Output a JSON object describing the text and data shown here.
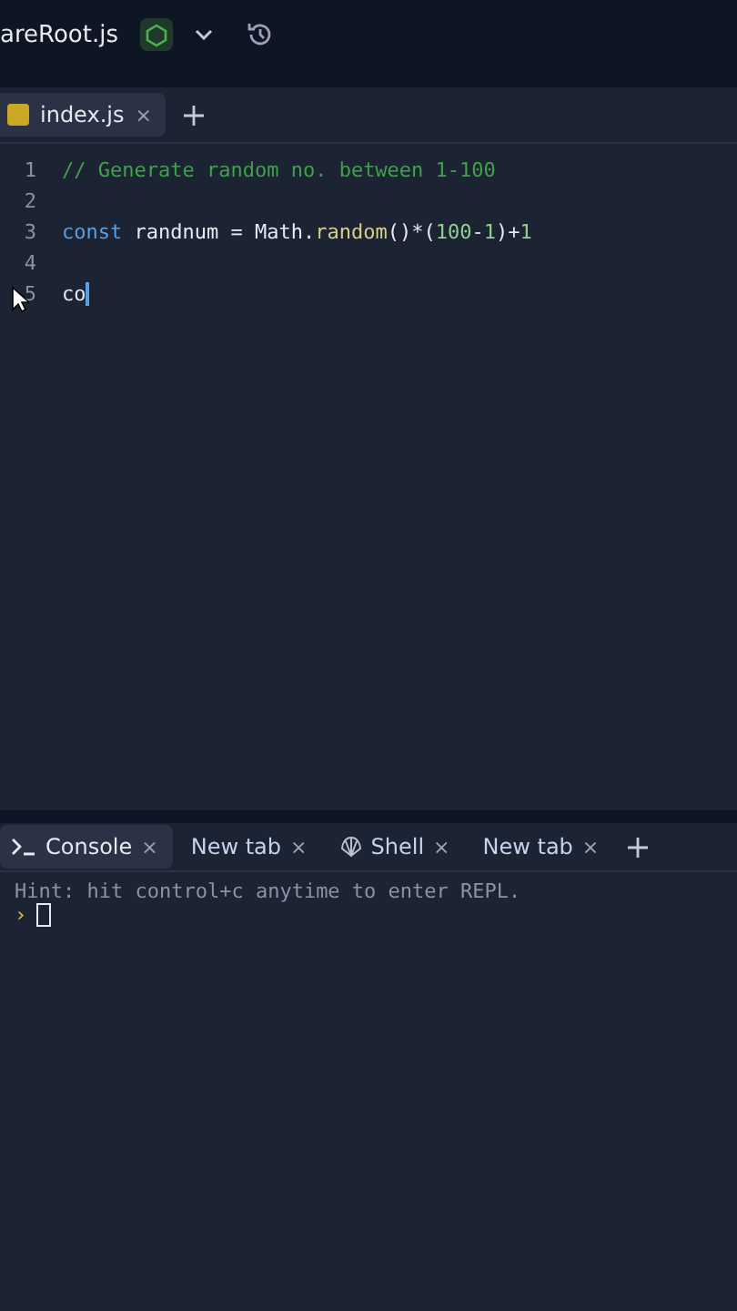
{
  "header": {
    "file_name": "areRoot.js"
  },
  "editor_tabs": [
    {
      "label": "index.js",
      "close": "×",
      "selected": true
    }
  ],
  "code_lines": [
    {
      "number": "1",
      "cursor": false,
      "tokens": [
        {
          "kind": "comment",
          "text": "// Generate random no. between 1-100"
        }
      ]
    },
    {
      "number": "2",
      "cursor": false
    },
    {
      "number": "3",
      "cursor": false,
      "tokens": [
        {
          "kind": "keyword",
          "text": "const"
        },
        {
          "kind": "plain",
          "text": " randnum = Math."
        },
        {
          "kind": "function",
          "text": "random"
        },
        {
          "kind": "plain",
          "text": "()*("
        },
        {
          "kind": "number",
          "text": "100"
        },
        {
          "kind": "plain",
          "text": "-"
        },
        {
          "kind": "number",
          "text": "1"
        },
        {
          "kind": "plain",
          "text": ")+"
        },
        {
          "kind": "number",
          "text": "1"
        }
      ]
    },
    {
      "number": "4",
      "cursor": false
    },
    {
      "number": "5",
      "cursor": true,
      "tokens": [
        {
          "kind": "plain",
          "text": "co"
        }
      ]
    }
  ],
  "console_tabs": [
    {
      "label": "Console",
      "kind": "terminal",
      "close": "×",
      "selected": true
    },
    {
      "label": "New tab",
      "kind": "plain",
      "close": "×",
      "selected": false
    },
    {
      "label": "Shell",
      "kind": "shell",
      "close": "×",
      "selected": false
    },
    {
      "label": "New tab",
      "kind": "plain",
      "close": "×",
      "selected": false
    }
  ],
  "console": {
    "hint": "Hint: hit control+c anytime to enter REPL.",
    "prompt": "›"
  }
}
